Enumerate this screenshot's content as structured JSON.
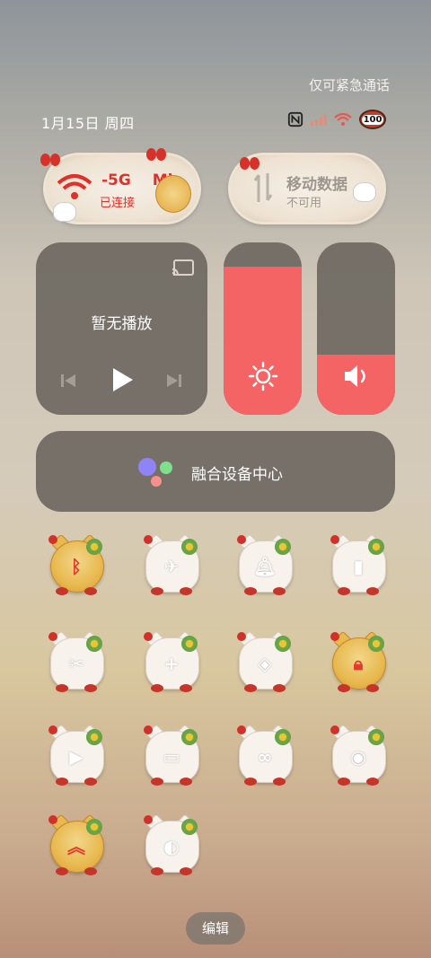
{
  "status": {
    "emergency_text": "仅可紧急通话",
    "date": "1月15日 周四",
    "battery": "100"
  },
  "connectivity": {
    "wifi": {
      "name": "-5G",
      "suffix": "Mi",
      "status": "已连接"
    },
    "mobile_data": {
      "name": "移动数据",
      "status": "不可用"
    }
  },
  "media": {
    "title": "暂无播放"
  },
  "sliders": {
    "brightness": {
      "level": 0.86
    },
    "volume": {
      "level": 0.35
    }
  },
  "fusion": {
    "label": "融合设备中心"
  },
  "toggles": [
    {
      "id": "bluetooth",
      "icon": "bluetooth-icon",
      "active": true
    },
    {
      "id": "airplane",
      "icon": "airplane-icon",
      "active": false
    },
    {
      "id": "silent",
      "icon": "bell-icon",
      "active": false
    },
    {
      "id": "flashlight",
      "icon": "flashlight-icon",
      "active": false
    },
    {
      "id": "screenshot",
      "icon": "scissors-icon",
      "active": false
    },
    {
      "id": "battery-saver",
      "icon": "battery-plus-icon",
      "active": false
    },
    {
      "id": "location",
      "icon": "location-icon",
      "active": false
    },
    {
      "id": "rotation-lock",
      "icon": "rotation-lock-icon",
      "active": true
    },
    {
      "id": "screen-record",
      "icon": "video-icon",
      "active": false
    },
    {
      "id": "cast",
      "icon": "cast-icon",
      "active": false
    },
    {
      "id": "hotspot",
      "icon": "link-icon",
      "active": false
    },
    {
      "id": "camera",
      "icon": "camera-icon",
      "active": false
    },
    {
      "id": "performance",
      "icon": "chevrons-up-icon",
      "active": true
    },
    {
      "id": "dark-mode",
      "icon": "contrast-icon",
      "active": false
    }
  ],
  "edit": {
    "label": "编辑"
  },
  "colors": {
    "accent": "#f46464",
    "panel": "#6e6861",
    "active_red": "#e23a2e"
  }
}
